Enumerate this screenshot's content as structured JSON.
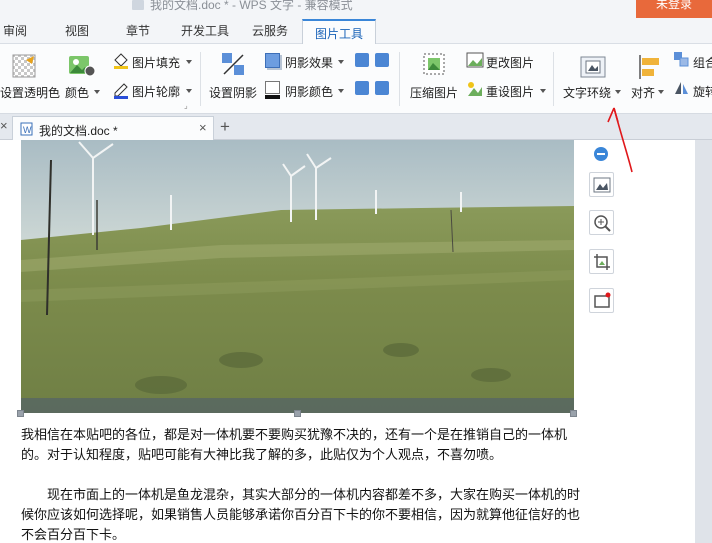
{
  "window": {
    "title": "我的文档.doc * - WPS 文字 - 兼容模式",
    "login_label": "未登录"
  },
  "menu": {
    "tabs": [
      "审阅",
      "视图",
      "章节",
      "开发工具",
      "云服务",
      "图片工具"
    ],
    "active_tab": "图片工具"
  },
  "ribbon": {
    "set_transparent": "设置透明色",
    "color": "颜色",
    "picture_fill": "图片填充",
    "picture_outline": "图片轮廓",
    "set_shadow": "设置阴影",
    "shadow_effect": "阴影效果",
    "shadow_color": "阴影颜色",
    "compress_picture": "压缩图片",
    "change_picture": "更改图片",
    "reset_picture": "重设图片",
    "text_wrap": "文字环绕",
    "align": "对齐",
    "group": "组合",
    "rotate": "旋转"
  },
  "doc_tab": {
    "label": "我的文档.doc *",
    "close_glyph": "×",
    "new_tab_glyph": "+"
  },
  "document": {
    "paragraph1": "我相信在本贴吧的各位，都是对一体机要不要购买犹豫不决的，还有一个是在推销自己的一体机的。对于认知程度，贴吧可能有大神比我了解的多，此贴仅为个人观点，不喜勿喷。",
    "paragraph2": "现在市面上的一体机是鱼龙混杂，其实大部分的一体机内容都差不多，大家在购买一体机的时候你应该如何选择呢，如果销售人员能够承诺你百分百下卡的你不要相信，因为就算他征信好的也不会百分百下卡。"
  },
  "colors": {
    "accent": "#3a86d8",
    "login_bg": "#e8693b",
    "annotation_red": "#e0181b"
  }
}
